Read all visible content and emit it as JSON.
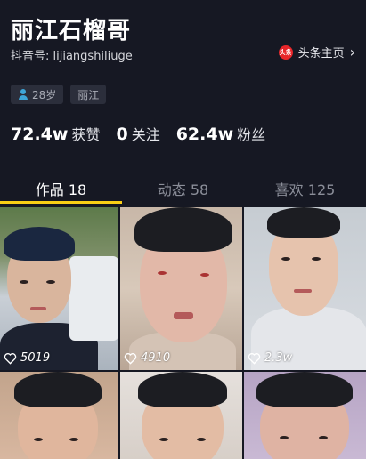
{
  "profile": {
    "name": "丽江石榴哥",
    "douyin_id": "抖音号: lijiangshiliuge",
    "toutiao_link": "头条主页",
    "toutiao_logo_text": "头条",
    "tags": [
      "28岁",
      "丽江"
    ]
  },
  "stats": [
    {
      "value": "72.4w",
      "label": "获赞"
    },
    {
      "value": "0",
      "label": "关注"
    },
    {
      "value": "62.4w",
      "label": "粉丝"
    }
  ],
  "tabs": [
    {
      "label": "作品 18",
      "active": true
    },
    {
      "label": "动态 58",
      "active": false
    },
    {
      "label": "喜欢 125",
      "active": false
    }
  ],
  "videos": [
    {
      "likes": "5019"
    },
    {
      "likes": "4910"
    },
    {
      "likes": "2.3w"
    },
    {
      "likes": ""
    },
    {
      "likes": ""
    },
    {
      "likes": ""
    }
  ],
  "colors": {
    "background": "#161823",
    "tab_indicator": "#face15",
    "toutiao_brand": "#e8262a",
    "tag_bg": "#2b2e3b"
  },
  "icons": {
    "toutiao": "toutiao-logo-icon",
    "chevron": "chevron-right-icon",
    "age": "person-icon",
    "like": "heart-icon"
  }
}
